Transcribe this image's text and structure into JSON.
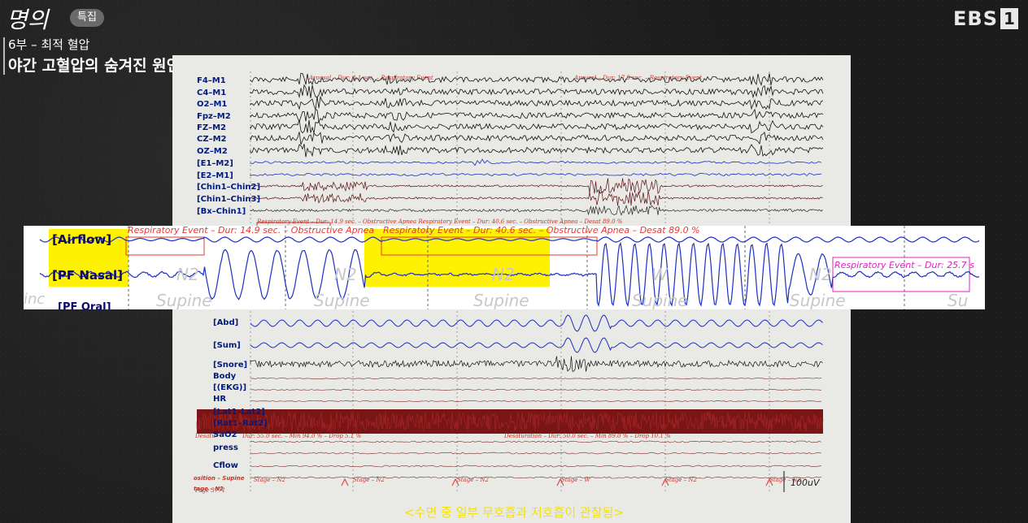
{
  "header": {
    "logo_text": "명의",
    "badge": "특집",
    "episode": "6부 – 최적 혈압",
    "subtitle": "야간 고혈압의 숨겨진 원인",
    "channel": "EBS",
    "channel_num": "1"
  },
  "chart": {
    "channels_top": [
      "F4–M1",
      "C4–M1",
      "O2–M1",
      "Fpz–M2",
      "FZ–M2",
      "CZ–M2",
      "OZ–M2",
      "[E1–M2]",
      "[E2–M1]",
      "[Chin1–Chin2]",
      "[Chin1–Chin3]",
      "[Bx–Chin1]"
    ],
    "channels_bottom": [
      "[Abd]",
      "[Sum]",
      "[Snore]",
      "Body",
      "[(EKG)]",
      "HR",
      "[Lat1–Lat2]",
      "[Rat1–Rat2]",
      "SaO2",
      "press",
      "Cflow",
      "osition – Supine",
      "tage – N2"
    ],
    "notes": {
      "arousal1": "Arousal – Dur: 4.1 sec. – Respiratory Event",
      "arousal2": "Arousal – Dur: 17.8 sec. – Respiratory Event",
      "row_resp": "Respiratory Event – Dur: 14.9 sec. – Obstructive Apnea  Respiratory Event – Dur: 40.6 sec. – Obstructive Apnea – Desat 89.0 %",
      "desat1": "Dur: 55.0 sec. – Min 94.0 % – Drop  5.1 %",
      "desat2": "Desaturation – Dur: 50.0 sec. – Min 89.0 % – Drop 10.1 %",
      "stage_marks": [
        "Stage – N2",
        "Stage – N2",
        "Stage – N2",
        "Stage – W",
        "Stage – N2",
        "Stage – N2"
      ],
      "desat_label": "Desatu",
      "page_no": "Page 3771"
    },
    "scale_label": "100uV"
  },
  "strip": {
    "label_airflow": "[Airflow]",
    "label_pf_nasal": "[PF Nasal]",
    "label_pf_oral": "[PF Oral]",
    "left_stub": "inc",
    "event1": "Respiratory Event – Dur: 14.9 sec. – Obstructive Apnea",
    "event2": "Respiratory Event – Dur: 40.6 sec. – Obstructive Apnea – Desat 89.0 %",
    "event3": "Respiratory Event – Dur: 25.7 s",
    "stages": [
      "N2",
      "N2",
      "N2",
      "W",
      "N2"
    ],
    "positions": [
      "Supine",
      "Supine",
      "Supine",
      "Supine",
      "Supine",
      "Su"
    ]
  },
  "caption": "<수면 중 일부 무호흡과 저호흡이 관찰됨>",
  "colors": {
    "trace_black": "#111111",
    "trace_blue": "#1b2fc4",
    "artifact_red": "#8b1a1a",
    "highlight": "#fff200",
    "event_red": "#e53935",
    "event_magenta": "#e020c0",
    "caption": "#f5e200"
  }
}
